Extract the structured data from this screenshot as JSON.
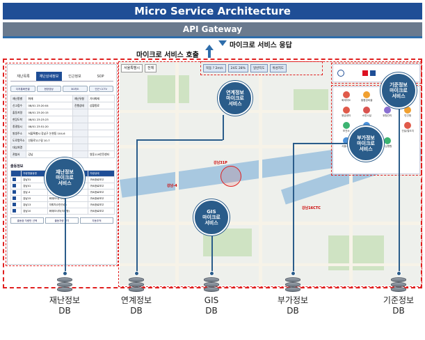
{
  "header": {
    "title": "Micro Service Architecture",
    "gateway": "API Gateway",
    "response_label": "마이크로 서비스 응답",
    "call_label": "마이크로 서비스 호출"
  },
  "callouts": {
    "disaster": "재난정보\n마이크로\n서비스",
    "linkage": "연계정보\n마이크로\n서비스",
    "gis": "GIS\n마이크로\n서비스",
    "additional": "부가정보\n마이크로\n서비스",
    "standard": "기준정보\n마이크로\n서비스"
  },
  "databases": [
    {
      "name": "재난정보",
      "suffix": "DB"
    },
    {
      "name": "연계정보",
      "suffix": "DB"
    },
    {
      "name": "GIS",
      "suffix": "DB"
    },
    {
      "name": "부가정보",
      "suffix": "DB"
    },
    {
      "name": "기준정보",
      "suffix": "DB"
    }
  ],
  "left_panel": {
    "tabs": [
      "재난목록",
      "재난상세정보",
      "인근정보",
      "SOP"
    ],
    "buttons": [
      "다자통화연결",
      "현장영상",
      "3D지도",
      "인근 CCTV"
    ],
    "info_rows": [
      {
        "k": "재난종별",
        "v": "화재",
        "k2": "재난유형",
        "v2": "기타화재"
      },
      {
        "k": "신고접수",
        "v": "08/01 23:20:04",
        "k2": "진행상태",
        "v2": "상황종료"
      },
      {
        "k": "출동지령",
        "v": "08/01 23:20:15",
        "k2": "",
        "v2": ""
      },
      {
        "k": "현장도착",
        "v": "08/01 23:23:23",
        "k2": "",
        "v2": ""
      },
      {
        "k": "종결일시",
        "v": "08/01 23:51:20",
        "k2": "",
        "v2": ""
      },
      {
        "k": "발생주소",
        "v": "서울특별시 강남구 논현동 104-6",
        "k2": "",
        "v2": ""
      },
      {
        "k": "도로명주소",
        "v": "선릉로117길 10-7",
        "k2": "",
        "v2": ""
      },
      {
        "k": "대상처명",
        "v": "",
        "k2": "",
        "v2": ""
      },
      {
        "k": "관할서",
        "v": "강남",
        "k2": "",
        "v2": "영동119안전센터"
      }
    ],
    "dispatch_title": "출동정보",
    "dispatch_header": [
      "차량명출동명",
      "차종",
      "차량상태"
    ],
    "dispatch_rows": [
      [
        "강남31",
        "물탱크차(4500)",
        "귀소완료보고"
      ],
      [
        "강남41",
        "펌프차(중형/산불개선)",
        "귀소완료보고"
      ],
      [
        "강남-4",
        "구조차(일반/중형)",
        "귀소완료보고"
      ],
      [
        "강남15",
        "화재조사(기타)",
        "귀소완료보고"
      ],
      [
        "강남13",
        "지휘차(3천인승)",
        "귀소완료보고"
      ],
      [
        "강남10",
        "화재조사차(지대형)",
        "귀소완료보고"
      ]
    ],
    "bottom_buttons": [
      "출동중 차량만 선택",
      "출동차량 보기",
      "자동추적"
    ]
  },
  "map": {
    "selects": [
      "서울특별시",
      "전체"
    ],
    "weather": [
      "북동 ? 2m/s",
      "24도 28%"
    ],
    "chips": [
      "일반지도",
      "위성지도"
    ],
    "incident_labels": [
      "강남31P",
      "강남-4",
      "강남16CTC"
    ]
  },
  "right_panel": {
    "items": [
      "화재지도",
      "통합장비출",
      "일정들",
      "구급차",
      "응급센터",
      "소방시설",
      "위험관리",
      "민간청",
      "보건소",
      "긴급차량",
      "",
      "건설/철도지",
      "서울시청",
      "서울소방",
      "도심병원",
      ""
    ]
  },
  "colors": {
    "title_bg": "#1f4e96",
    "gateway_bg": "#6a7a8e",
    "accent": "#2a5c8a",
    "dashed": "#e02020"
  }
}
